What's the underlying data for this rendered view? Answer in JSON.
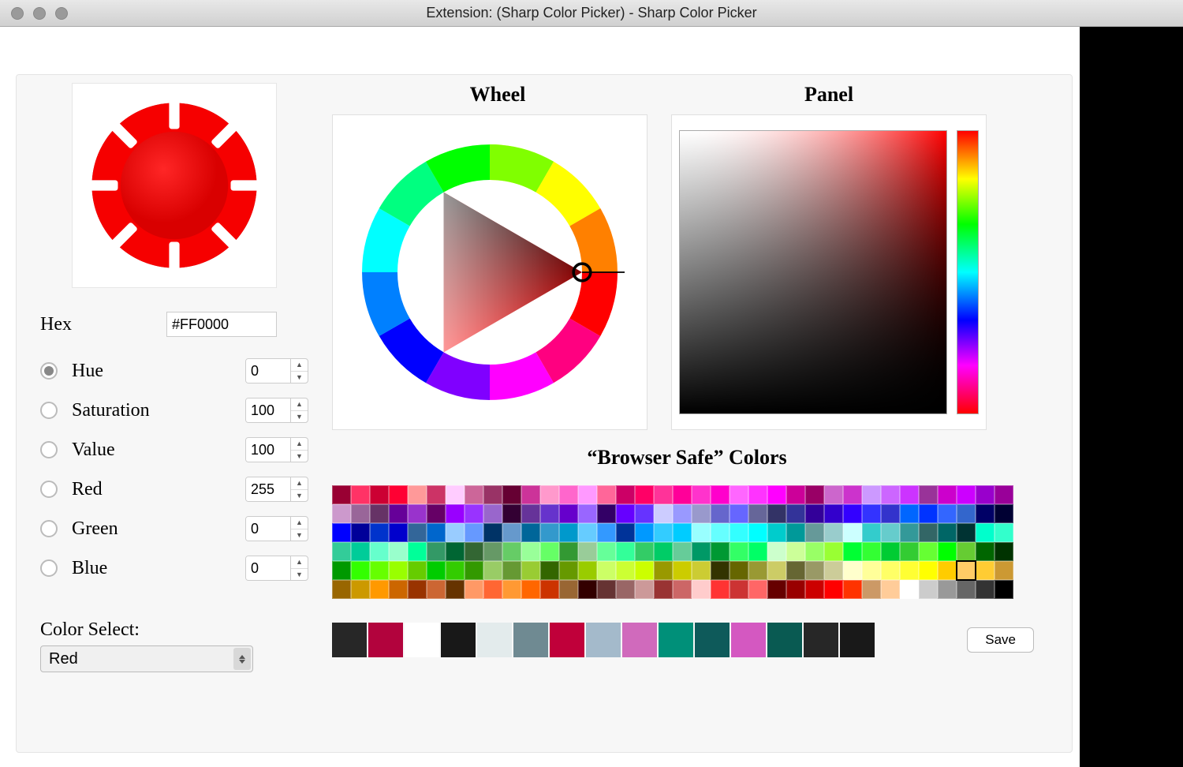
{
  "window": {
    "title": "Extension: (Sharp Color Picker) - Sharp Color Picker"
  },
  "left": {
    "hex_label": "Hex",
    "hex_value": "#FF0000",
    "channels": [
      {
        "key": "hue",
        "label": "Hue",
        "value": 0,
        "selected": true
      },
      {
        "key": "saturation",
        "label": "Saturation",
        "value": 100,
        "selected": false
      },
      {
        "key": "value",
        "label": "Value",
        "value": 100,
        "selected": false
      },
      {
        "key": "red",
        "label": "Red",
        "value": 255,
        "selected": false
      },
      {
        "key": "green",
        "label": "Green",
        "value": 0,
        "selected": false
      },
      {
        "key": "blue",
        "label": "Blue",
        "value": 0,
        "selected": false
      }
    ],
    "color_select_label": "Color Select:",
    "color_select_value": "Red"
  },
  "headings": {
    "wheel": "Wheel",
    "panel": "Panel",
    "browser_safe": "“Browser Safe” Colors"
  },
  "current_color": "#FF0000",
  "browser_safe_selected_index": 177,
  "browser_safe_colors": [
    "#990033",
    "#ff3366",
    "#cc0033",
    "#ff0033",
    "#ff9999",
    "#cc3366",
    "#ffccff",
    "#cc6699",
    "#993366",
    "#660033",
    "#cc3399",
    "#ff99cc",
    "#ff66cc",
    "#ff99ff",
    "#ff6699",
    "#cc0066",
    "#ff0066",
    "#ff3399",
    "#ff0099",
    "#ff33cc",
    "#ff00cc",
    "#ff66ff",
    "#ff33ff",
    "#ff00ff",
    "#cc0099",
    "#990066",
    "#cc66cc",
    "#cc33cc",
    "#cc99ff",
    "#cc66ff",
    "#cc33ff",
    "#993399",
    "#cc00cc",
    "#cc00ff",
    "#9900cc",
    "#990099",
    "#cc99cc",
    "#996699",
    "#663366",
    "#660099",
    "#9933cc",
    "#660066",
    "#9900ff",
    "#9933ff",
    "#9966cc",
    "#330033",
    "#663399",
    "#6633cc",
    "#6600cc",
    "#9966ff",
    "#330066",
    "#6600ff",
    "#6633ff",
    "#ccccff",
    "#9999ff",
    "#9999cc",
    "#6666cc",
    "#6666ff",
    "#666699",
    "#333366",
    "#333399",
    "#330099",
    "#3300cc",
    "#3300ff",
    "#3333ff",
    "#3333cc",
    "#0066ff",
    "#0033ff",
    "#3366ff",
    "#3366cc",
    "#000066",
    "#000033",
    "#0000ff",
    "#000099",
    "#0033cc",
    "#0000cc",
    "#336699",
    "#0066cc",
    "#99ccff",
    "#6699ff",
    "#003366",
    "#6699cc",
    "#006699",
    "#3399cc",
    "#0099cc",
    "#66ccff",
    "#3399ff",
    "#003399",
    "#0099ff",
    "#33ccff",
    "#00ccff",
    "#99ffff",
    "#66ffff",
    "#33ffff",
    "#00ffff",
    "#00cccc",
    "#009999",
    "#669999",
    "#99cccc",
    "#ccffff",
    "#33cccc",
    "#66cccc",
    "#339999",
    "#336666",
    "#006666",
    "#003333",
    "#00ffcc",
    "#33ffcc",
    "#33cc99",
    "#00cc99",
    "#66ffcc",
    "#99ffcc",
    "#00ff99",
    "#339966",
    "#006633",
    "#336633",
    "#669966",
    "#66cc66",
    "#99ff99",
    "#66ff66",
    "#339933",
    "#99cc99",
    "#66ff99",
    "#33ff99",
    "#33cc66",
    "#00cc66",
    "#66cc99",
    "#009966",
    "#009933",
    "#33ff66",
    "#00ff66",
    "#ccffcc",
    "#ccff99",
    "#99ff66",
    "#99ff33",
    "#00ff33",
    "#33ff33",
    "#00cc33",
    "#33cc33",
    "#66ff33",
    "#00ff00",
    "#66cc33",
    "#006600",
    "#003300",
    "#009900",
    "#33ff00",
    "#66ff00",
    "#99ff00",
    "#66cc00",
    "#00cc00",
    "#33cc00",
    "#339900",
    "#99cc66",
    "#669933",
    "#99cc33",
    "#336600",
    "#669900",
    "#99cc00",
    "#ccff66",
    "#ccff33",
    "#ccff00",
    "#999900",
    "#cccc00",
    "#cccc33",
    "#333300",
    "#666600",
    "#999933",
    "#cccc66",
    "#666633",
    "#999966",
    "#cccc99",
    "#ffffcc",
    "#ffff99",
    "#ffff66",
    "#ffff33",
    "#ffff00",
    "#ffcc00",
    "#ffcc66",
    "#ffcc33",
    "#cc9933",
    "#996600",
    "#cc9900",
    "#ff9900",
    "#cc6600",
    "#993300",
    "#cc6633",
    "#663300",
    "#ff9966",
    "#ff6633",
    "#ff9933",
    "#ff6600",
    "#cc3300",
    "#996633",
    "#330000",
    "#663333",
    "#996666",
    "#cc9999",
    "#993333",
    "#cc6666",
    "#ffcccc",
    "#ff3333",
    "#cc3333",
    "#ff6666",
    "#660000",
    "#990000",
    "#cc0000",
    "#ff0000",
    "#ff3300",
    "#cc9966",
    "#ffcc99",
    "#ffffff",
    "#cccccc",
    "#999999",
    "#666666",
    "#333333",
    "#000000"
  ],
  "recent_colors": [
    "#272727",
    "#b2033d",
    "#ffffff",
    "#181818",
    "#e3ebec",
    "#6f8a92",
    "#c0003a",
    "#a4bacb",
    "#d06abc",
    "#009079",
    "#0e5a5a",
    "#d458c1",
    "#095a52",
    "#272727",
    "#191919"
  ],
  "save_label": "Save"
}
